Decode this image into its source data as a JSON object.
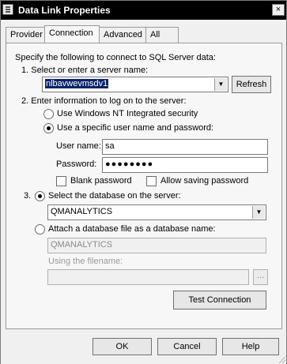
{
  "window": {
    "title": "Data Link Properties",
    "close_glyph": "×"
  },
  "tabs": [
    {
      "label": "Provider"
    },
    {
      "label": "Connection"
    },
    {
      "label": "Advanced"
    },
    {
      "label": "All"
    }
  ],
  "connection": {
    "intro": "Specify the following to connect to SQL Server data:",
    "step1": {
      "label": "1. Select or enter a server name:",
      "server_value": "nlbavwevmsdv1",
      "refresh_label": "Refresh"
    },
    "step2": {
      "label": "2. Enter information to log on to the server:",
      "option_windows": "Use Windows NT Integrated security",
      "option_specific": "Use a specific user name and password:",
      "username_label": "User name:",
      "username_value": "sa",
      "password_label": "Password:",
      "password_value": "●●●●●●●●",
      "blank_password_label": "Blank password",
      "allow_saving_label": "Allow saving password"
    },
    "step3": {
      "number": "3.",
      "select_db_label": "Select the database on the server:",
      "database_value": "QMANALYTICS",
      "attach_label": "Attach a database file as a database name:",
      "attach_value": "QMANALYTICS",
      "filename_label": "Using the filename:",
      "filename_value": "",
      "browse_label": "..."
    },
    "test_connection_label": "Test Connection"
  },
  "footer": {
    "ok_label": "OK",
    "cancel_label": "Cancel",
    "help_label": "Help"
  },
  "state": {
    "active_tab": "Connection",
    "auth_mode": "specific",
    "database_mode": "select"
  }
}
